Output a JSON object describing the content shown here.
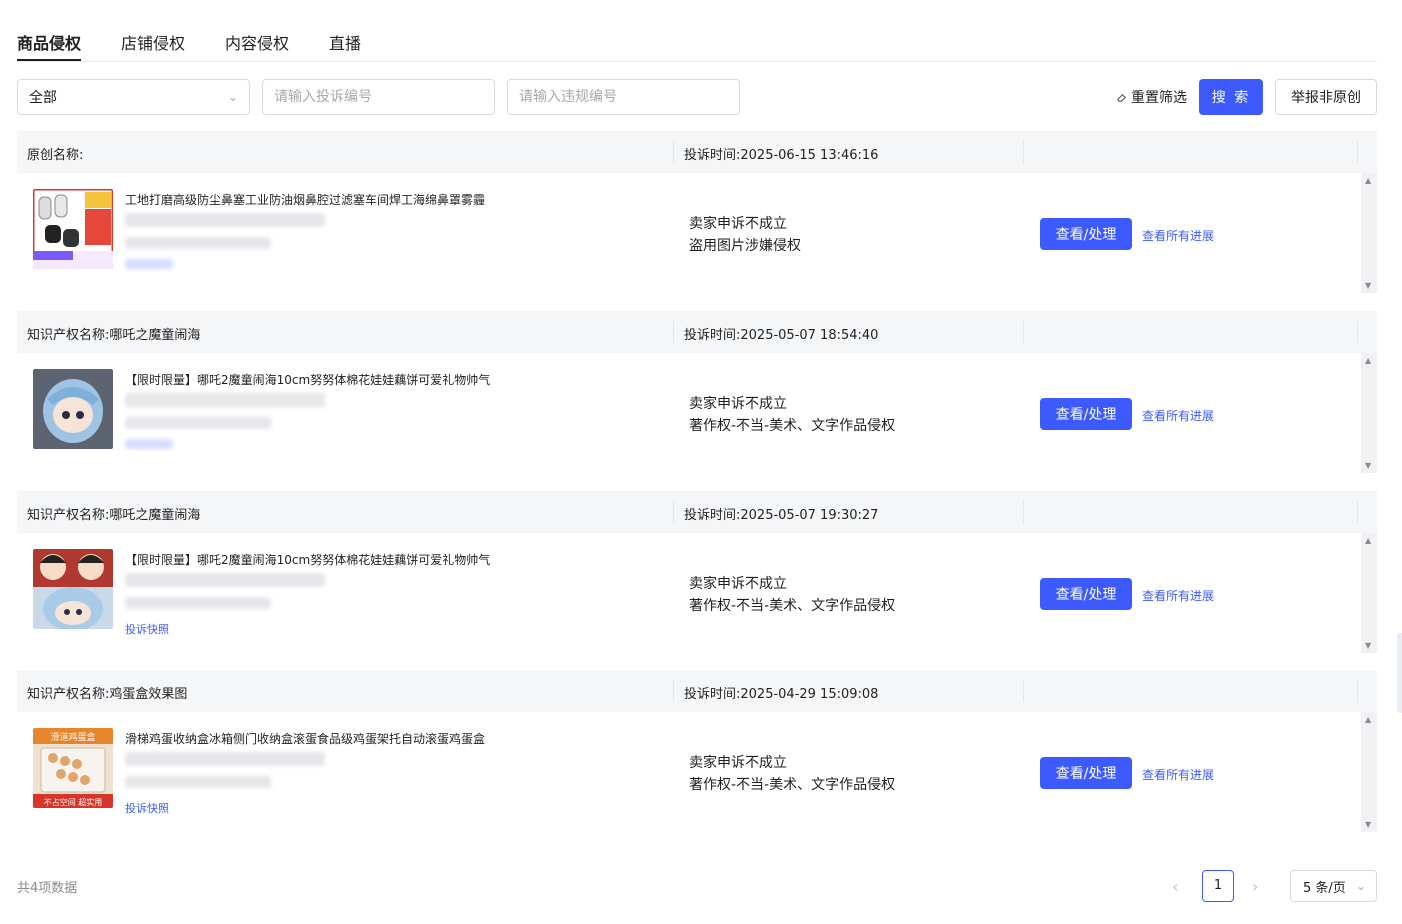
{
  "tabs": [
    "商品侵权",
    "店铺侵权",
    "内容侵权",
    "直播"
  ],
  "filters": {
    "select_value": "全部",
    "complaint_placeholder": "请输入投诉编号",
    "violation_placeholder": "请输入违规编号",
    "reset_label": "重置筛选",
    "search_label": "搜 索",
    "report_label": "举报非原创"
  },
  "records": [
    {
      "title": "原创名称:",
      "time": "投诉时间:2025-06-15 13:46:16",
      "product_title": "工地打磨高级防尘鼻塞工业防油烟鼻腔过滤塞车间焊工海绵鼻罩雾霾",
      "status_line1": "卖家申诉不成立",
      "status_line2": "盗用图片涉嫌侵权",
      "view_label": "查看/处理",
      "progress_label": "查看所有进展"
    },
    {
      "title": "知识产权名称:哪吒之魔童闹海",
      "time": "投诉时间:2025-05-07 18:54:40",
      "product_title": "【限时限量】哪吒2魔童闹海10cm努努体棉花娃娃藕饼可爱礼物帅气",
      "status_line1": "卖家申诉不成立",
      "status_line2": "著作权-不当-美术、文字作品侵权",
      "view_label": "查看/处理",
      "progress_label": "查看所有进展"
    },
    {
      "title": "知识产权名称:哪吒之魔童闹海",
      "time": "投诉时间:2025-05-07 19:30:27",
      "product_title": "【限时限量】哪吒2魔童闹海10cm努努体棉花娃娃藕饼可爱礼物帅气",
      "status_line1": "卖家申诉不成立",
      "status_line2": "著作权-不当-美术、文字作品侵权",
      "view_label": "查看/处理",
      "progress_label": "查看所有进展",
      "evidence_label": "投诉快照"
    },
    {
      "title": "知识产权名称:鸡蛋盒效果图",
      "time": "投诉时间:2025-04-29 15:09:08",
      "product_title": "滑梯鸡蛋收纳盒冰箱侧门收纳盒滚蛋食品级鸡蛋架托自动滚蛋鸡蛋盒",
      "status_line1": "卖家申诉不成立",
      "status_line2": "著作权-不当-美术、文字作品侵权",
      "view_label": "查看/处理",
      "progress_label": "查看所有进展",
      "evidence_label": "投诉快照",
      "image_text_top": "滑道鸡蛋盒",
      "image_text_bottom": "不占空间 超实用"
    }
  ],
  "pagination": {
    "total": "共4项数据",
    "current": "1",
    "page_size": "5 条/页"
  },
  "colors": {
    "primary": "#3d5aff",
    "header_bg": "#f5f6f8"
  }
}
